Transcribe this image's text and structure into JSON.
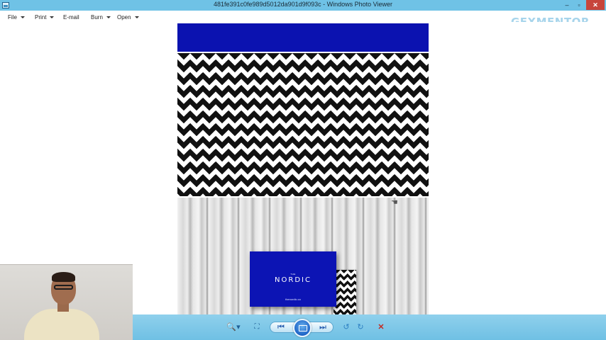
{
  "window": {
    "title": "481fe391c0fe989d5012da901d9f093c - Windows Photo Viewer",
    "minimize_glyph": "–",
    "maximize_glyph": "▫",
    "close_glyph": "✕"
  },
  "menu": {
    "items": [
      {
        "label": "File",
        "has_dropdown": true
      },
      {
        "label": "Print",
        "has_dropdown": true
      },
      {
        "label": "E-mail",
        "has_dropdown": false
      },
      {
        "label": "Burn",
        "has_dropdown": true
      },
      {
        "label": "Open",
        "has_dropdown": true
      }
    ],
    "help_glyph": "?"
  },
  "watermark": {
    "text": "GFXMENTOR"
  },
  "image": {
    "card_prefix": "THE",
    "card_brand": "NORDIC",
    "card_site": "thenordic.co",
    "colors": {
      "brand_blue": "#0b12b0",
      "chevron_dark": "#111111",
      "wood_light": "#e6e6e6"
    }
  },
  "toolbar": {
    "zoom_glyph": "🔍▾",
    "actual_size_glyph": "⛶",
    "previous_glyph": "⏮",
    "next_glyph": "⏭",
    "rotate_ccw_glyph": "↺",
    "rotate_cw_glyph": "↻",
    "delete_glyph": "✕"
  },
  "icons": [
    "photo-viewer-icon",
    "help-icon",
    "zoom-icon",
    "actual-size-icon",
    "previous-icon",
    "slideshow-icon",
    "next-icon",
    "rotate-counterclockwise-icon",
    "rotate-clockwise-icon",
    "delete-icon",
    "hand-cursor-icon"
  ]
}
